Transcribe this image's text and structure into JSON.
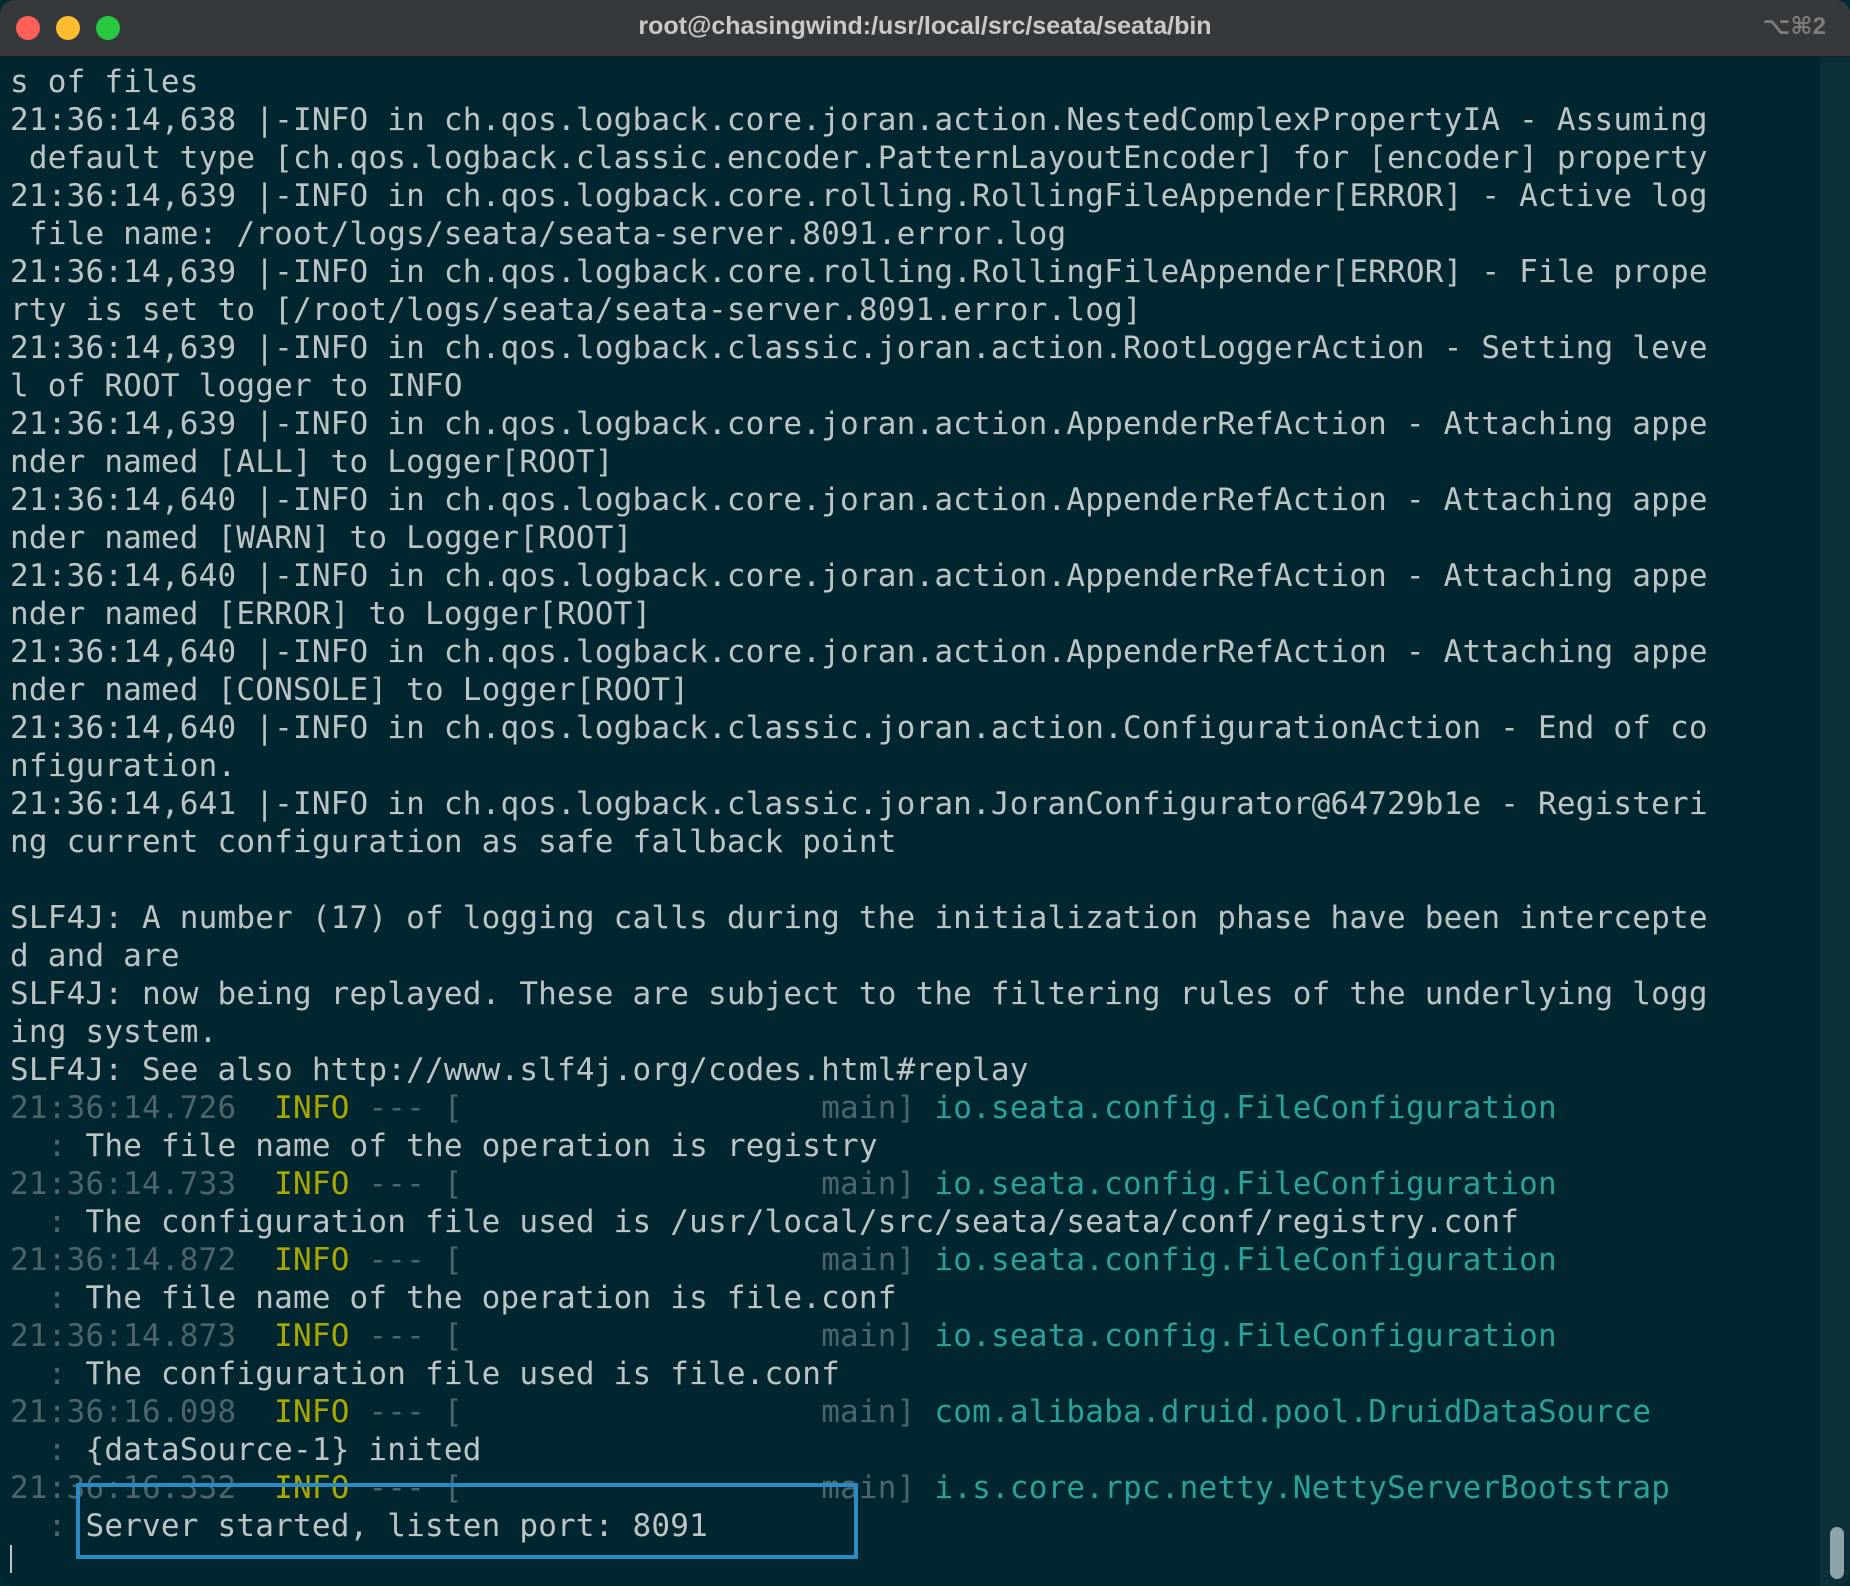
{
  "window": {
    "title": "root@chasingwind:/usr/local/src/seata/seata/bin",
    "shortcut": "⌥⌘2"
  },
  "log_lines": [
    "s of files",
    "21:36:14,638 |-INFO in ch.qos.logback.core.joran.action.NestedComplexPropertyIA - Assuming",
    " default type [ch.qos.logback.classic.encoder.PatternLayoutEncoder] for [encoder] property",
    "21:36:14,639 |-INFO in ch.qos.logback.core.rolling.RollingFileAppender[ERROR] - Active log",
    " file name: /root/logs/seata/seata-server.8091.error.log",
    "21:36:14,639 |-INFO in ch.qos.logback.core.rolling.RollingFileAppender[ERROR] - File prope",
    "rty is set to [/root/logs/seata/seata-server.8091.error.log]",
    "21:36:14,639 |-INFO in ch.qos.logback.classic.joran.action.RootLoggerAction - Setting leve",
    "l of ROOT logger to INFO",
    "21:36:14,639 |-INFO in ch.qos.logback.core.joran.action.AppenderRefAction - Attaching appe",
    "nder named [ALL] to Logger[ROOT]",
    "21:36:14,640 |-INFO in ch.qos.logback.core.joran.action.AppenderRefAction - Attaching appe",
    "nder named [WARN] to Logger[ROOT]",
    "21:36:14,640 |-INFO in ch.qos.logback.core.joran.action.AppenderRefAction - Attaching appe",
    "nder named [ERROR] to Logger[ROOT]",
    "21:36:14,640 |-INFO in ch.qos.logback.core.joran.action.AppenderRefAction - Attaching appe",
    "nder named [CONSOLE] to Logger[ROOT]",
    "21:36:14,640 |-INFO in ch.qos.logback.classic.joran.action.ConfigurationAction - End of co",
    "nfiguration.",
    "21:36:14,641 |-INFO in ch.qos.logback.classic.joran.JoranConfigurator@64729b1e - Registeri",
    "ng current configuration as safe fallback point",
    "",
    "SLF4J: A number (17) of logging calls during the initialization phase have been intercepte",
    "d and are",
    "SLF4J: now being replayed. These are subject to the filtering rules of the underlying logg",
    "ing system.",
    "SLF4J: See also http://www.slf4j.org/codes.html#replay"
  ],
  "seata_entries": [
    {
      "time": "21:36:14.726",
      "level": "INFO",
      "sep": " --- [",
      "thread": "main]",
      "logger": "io.seata.config.FileConfiguration",
      "message": "The file name of the operation is registry"
    },
    {
      "time": "21:36:14.733",
      "level": "INFO",
      "sep": " --- [",
      "thread": "main]",
      "logger": "io.seata.config.FileConfiguration",
      "message": "The configuration file used is /usr/local/src/seata/seata/conf/registry.conf"
    },
    {
      "time": "21:36:14.872",
      "level": "INFO",
      "sep": " --- [",
      "thread": "main]",
      "logger": "io.seata.config.FileConfiguration",
      "message": "The file name of the operation is file.conf"
    },
    {
      "time": "21:36:14.873",
      "level": "INFO",
      "sep": " --- [",
      "thread": "main]",
      "logger": "io.seata.config.FileConfiguration",
      "message": "The configuration file used is file.conf"
    },
    {
      "time": "21:36:16.098",
      "level": "INFO",
      "sep": " --- [",
      "thread": "main]",
      "logger": "com.alibaba.druid.pool.DruidDataSource",
      "message": "{dataSource-1} inited"
    },
    {
      "time": "21:36:16.332",
      "level": "INFO",
      "sep": " --- [",
      "thread": "main]",
      "logger": "i.s.core.rpc.netty.NettyServerBootstrap",
      "message": "Server started, listen port: 8091"
    }
  ],
  "message_prefix": "  : ",
  "colors": {
    "background": "#022630",
    "text": "#bcc4c5",
    "dim": "#4d656a",
    "level": "#a8a600",
    "logger": "#2aa198",
    "highlight": "#2b89c4"
  }
}
